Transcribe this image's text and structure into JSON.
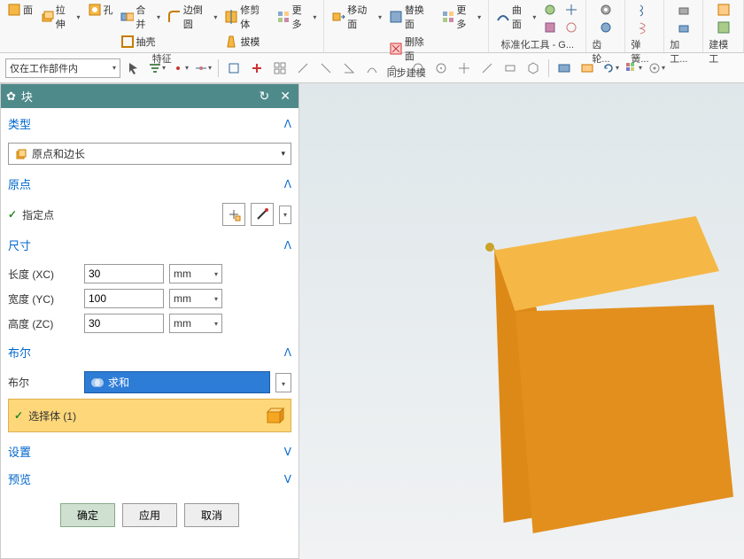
{
  "ribbon": {
    "groups": [
      {
        "label": "特征",
        "items": [
          "面",
          "拉伸",
          "孔",
          "合并",
          "抽壳",
          "边倒圆",
          "修剪体",
          "拔模",
          "更多"
        ]
      },
      {
        "label": "同步建模",
        "items": [
          "移动面",
          "替换面",
          "删除面",
          "更多"
        ]
      },
      {
        "label": "标准化工具 - G...",
        "items": [
          "曲面"
        ]
      },
      {
        "label": "齿轮...",
        "items": []
      },
      {
        "label": "弹簧...",
        "items": []
      },
      {
        "label": "加工...",
        "items": []
      },
      {
        "label": "建模工",
        "items": []
      }
    ]
  },
  "toolbar": {
    "scope": "仅在工作部件内"
  },
  "dialog": {
    "title": "块",
    "type": {
      "label": "类型",
      "value": "原点和边长"
    },
    "origin": {
      "label": "原点",
      "specify": "指定点"
    },
    "dim": {
      "label": "尺寸",
      "length_label": "长度 (XC)",
      "length": "30",
      "width_label": "宽度 (YC)",
      "width": "100",
      "height_label": "高度 (ZC)",
      "height": "30",
      "unit": "mm"
    },
    "boolean": {
      "label": "布尔",
      "field": "布尔",
      "value": "求和",
      "select": "选择体 (1)"
    },
    "settings": "设置",
    "preview": "预览",
    "buttons": {
      "ok": "确定",
      "apply": "应用",
      "cancel": "取消"
    }
  }
}
